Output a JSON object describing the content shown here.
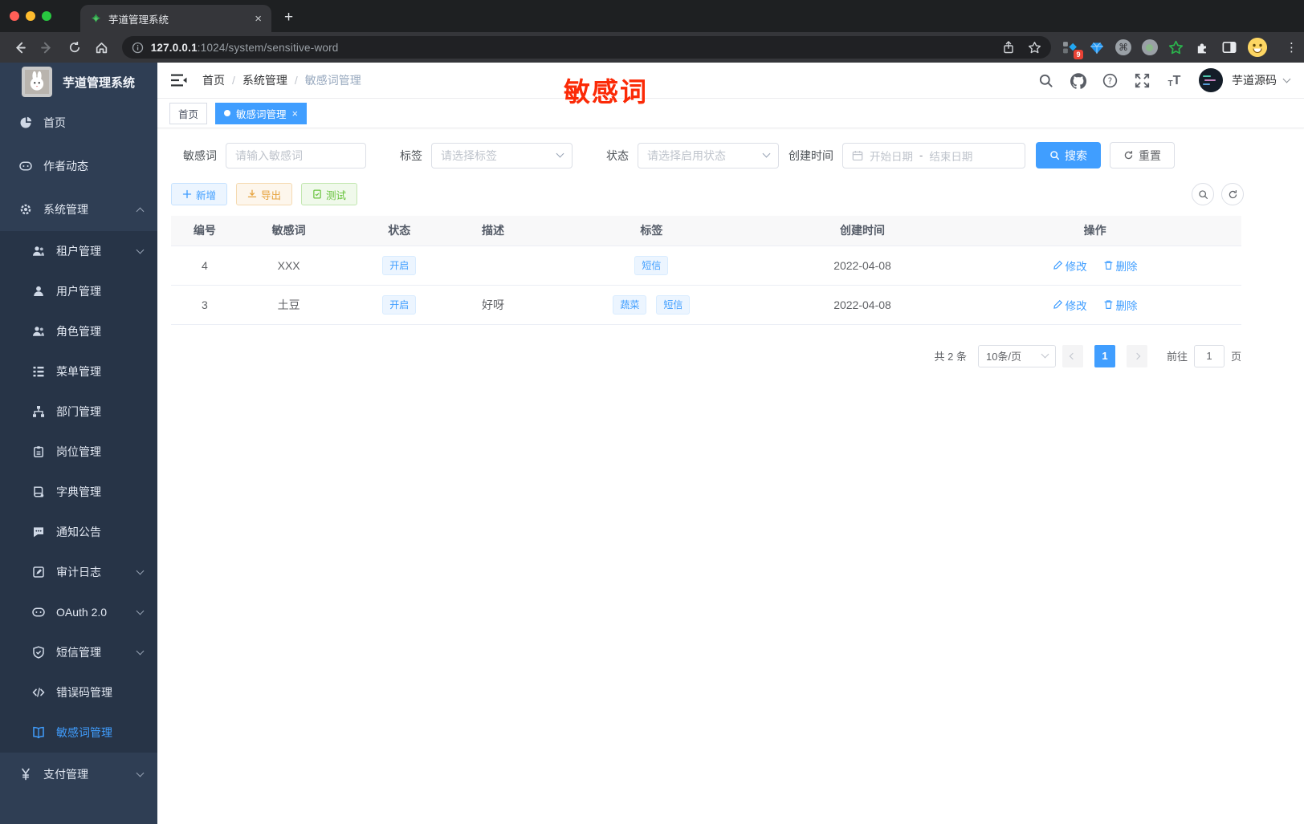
{
  "browser": {
    "tab_title": "芋道管理系统",
    "close_tab": "×",
    "new_tab": "+",
    "url_host": "127.0.0.1",
    "url_path": ":1024/system/sensitive-word",
    "extension_badge": "9",
    "menu_dots": "⋮"
  },
  "annotation": {
    "text": "敏感词",
    "color": "#fb2a07"
  },
  "sidebar": {
    "title": "芋道管理系统",
    "items": [
      {
        "label": "首页"
      },
      {
        "label": "作者动态"
      },
      {
        "label": "系统管理"
      },
      {
        "label": "租户管理"
      },
      {
        "label": "用户管理"
      },
      {
        "label": "角色管理"
      },
      {
        "label": "菜单管理"
      },
      {
        "label": "部门管理"
      },
      {
        "label": "岗位管理"
      },
      {
        "label": "字典管理"
      },
      {
        "label": "通知公告"
      },
      {
        "label": "审计日志"
      },
      {
        "label": "OAuth 2.0"
      },
      {
        "label": "短信管理"
      },
      {
        "label": "错误码管理"
      },
      {
        "label": "敏感词管理"
      },
      {
        "label": "支付管理"
      }
    ]
  },
  "header": {
    "breadcrumb": {
      "home": "首页",
      "section": "系统管理",
      "current": "敏感词管理",
      "separator": "/"
    },
    "username": "芋道源码"
  },
  "tabs": {
    "first": "首页",
    "active": "敏感词管理",
    "close": "×"
  },
  "filters": {
    "keyword_label": "敏感词",
    "keyword_placeholder": "请输入敏感词",
    "tag_label": "标签",
    "tag_placeholder": "请选择标签",
    "status_label": "状态",
    "status_placeholder": "请选择启用状态",
    "date_label": "创建时间",
    "date_start_placeholder": "开始日期",
    "date_separator": "-",
    "date_end_placeholder": "结束日期",
    "search_label": "搜索",
    "reset_label": "重置"
  },
  "actions": {
    "add": "新增",
    "export": "导出",
    "test": "测试"
  },
  "table": {
    "columns": {
      "id": "编号",
      "word": "敏感词",
      "status": "状态",
      "description": "描述",
      "tags": "标签",
      "created": "创建时间",
      "operations": "操作"
    },
    "rows": [
      {
        "id": "4",
        "word": "XXX",
        "status": "开启",
        "description": "",
        "tag1": "短信",
        "created": "2022-04-08"
      },
      {
        "id": "3",
        "word": "土豆",
        "status": "开启",
        "description": "好呀",
        "tag1": "蔬菜",
        "tag2": "短信",
        "created": "2022-04-08"
      }
    ],
    "edit": "修改",
    "delete": "删除"
  },
  "pagination": {
    "total": "共 2 条",
    "page_size": "10条/页",
    "page": "1",
    "goto": "前往",
    "goto_value": "1",
    "unit": "页"
  },
  "colors": {
    "primary": "#409eff",
    "warning": "#e6a23c",
    "success": "#67c23a",
    "annotation_red": "#fb2a07",
    "sidebar_bg": "#2f3e54",
    "submenu_bg": "#273447",
    "tag_bg": "#ecf5ff",
    "tag_border": "#d9ecff",
    "traffic_red": "#ff5f57",
    "traffic_yellow": "#febc2e",
    "traffic_green": "#28c840"
  }
}
